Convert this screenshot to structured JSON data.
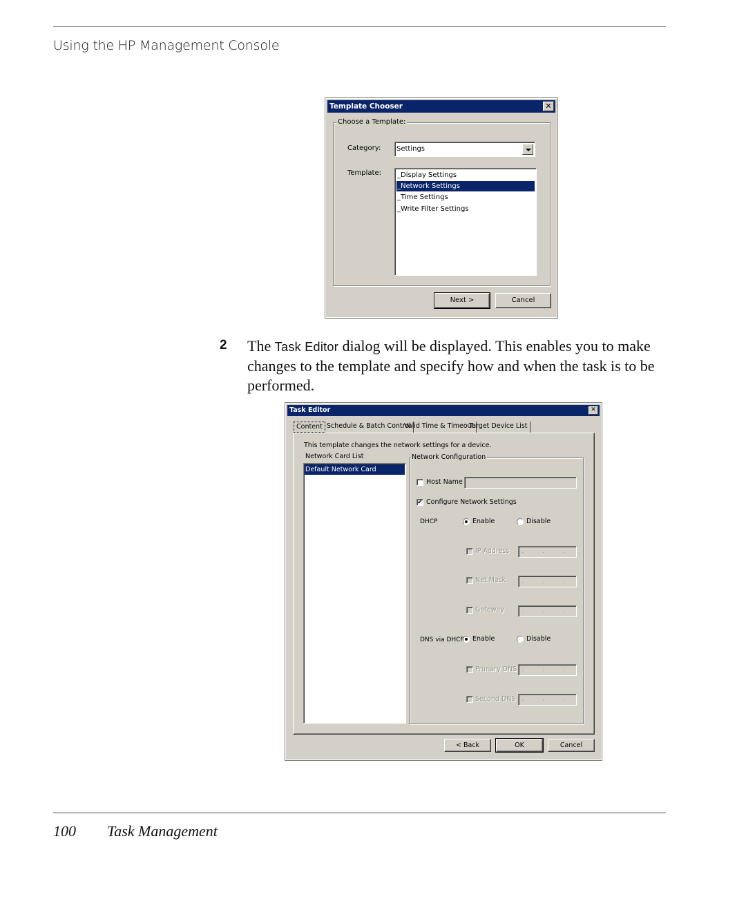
{
  "page": {
    "running_head": "Using the HP Management Console",
    "footer_page_number": "100",
    "footer_section": "Task Management"
  },
  "step": {
    "number": "2",
    "text_before": "The ",
    "code": "Task Editor",
    "text_after": " dialog will be displayed. This enables you to make changes to the template and specify how and when the task is to be performed."
  },
  "template_chooser": {
    "title": "Template Chooser",
    "close_icon": "close-icon",
    "group_label": "Choose a Template:",
    "category_label": "Category:",
    "category_value": "Settings",
    "template_label": "Template:",
    "templates": [
      {
        "label": "_Display Settings",
        "selected": false
      },
      {
        "label": "_Network Settings",
        "selected": true
      },
      {
        "label": "_Time Settings",
        "selected": false
      },
      {
        "label": "_Write Filter Settings",
        "selected": false
      }
    ],
    "next_button": "Next >",
    "cancel_button": "Cancel"
  },
  "task_editor": {
    "title": "Task Editor",
    "close_icon": "close-icon",
    "tabs": [
      {
        "label": "Content",
        "active": true
      },
      {
        "label": "Schedule & Batch Control",
        "active": false
      },
      {
        "label": "Valid Time & Timeout",
        "active": false
      },
      {
        "label": "Target Device List",
        "active": false
      }
    ],
    "description": "This template changes the network settings for a device.",
    "network_card_list_label": "Network Card List",
    "network_cards": [
      {
        "label": "Default Network Card",
        "selected": true
      }
    ],
    "network_config_label": "Network Configuration",
    "host_name": {
      "label": "Host Name",
      "checked": false,
      "value": ""
    },
    "configure_network": {
      "label": "Configure Network Settings",
      "checked": true
    },
    "dhcp": {
      "label": "DHCP",
      "enable_label": "Enable",
      "disable_label": "Disable",
      "selected": "Enable"
    },
    "ip_address": {
      "label": "IP Address",
      "checked": false,
      "enabled": false,
      "value": ". . ."
    },
    "net_mask": {
      "label": "Net Mask",
      "checked": false,
      "enabled": false,
      "value": ". . ."
    },
    "gateway": {
      "label": "Gateway",
      "checked": false,
      "enabled": false,
      "value": ". . ."
    },
    "dns_via_dhcp": {
      "label": "DNS via DHCP",
      "enable_label": "Enable",
      "disable_label": "Disable",
      "selected": "Enable"
    },
    "primary_dns": {
      "label": "Primary DNS",
      "checked": false,
      "enabled": false,
      "value": ". . ."
    },
    "second_dns": {
      "label": "Second DNS",
      "checked": false,
      "enabled": false,
      "value": ". . ."
    },
    "back_button": "< Back",
    "ok_button": "OK",
    "cancel_button": "Cancel",
    "check_mark": "✔"
  },
  "colors": {
    "titlebar": "#0a246a",
    "dialog_face": "#d4d0c8",
    "selection": "#0a246a"
  }
}
